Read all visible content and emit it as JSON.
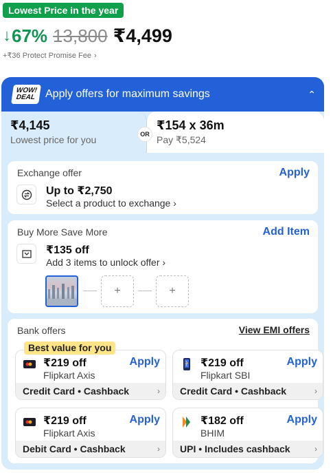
{
  "pricing": {
    "badge": "Lowest Price in the year",
    "discount": "67%",
    "mrp": "13,800",
    "final_price": "₹4,499",
    "fee_text": "+₹36 Protect Promise Fee"
  },
  "offers": {
    "header_logo_line1": "WOW!",
    "header_logo_line2": "DEAL",
    "header_title": "Apply offers for maximum savings",
    "left_tab": {
      "amount": "₹4,145",
      "sub": "Lowest price for you"
    },
    "or_label": "OR",
    "right_tab": {
      "amount": "₹154 x 36m",
      "sub": "Pay ₹5,524"
    }
  },
  "exchange": {
    "title": "Exchange offer",
    "action": "Apply",
    "main": "Up to ₹2,750",
    "sub": "Select a product to exchange"
  },
  "buy_more": {
    "title": "Buy More Save More",
    "action": "Add Item",
    "main": "₹135 off",
    "sub": "Add 3 items to unlock offer",
    "slot_symbol": "+"
  },
  "bank": {
    "title": "Bank offers",
    "view_emi": "View EMI offers",
    "best_value": "Best value for you",
    "cards": [
      {
        "amount": "₹219 off",
        "bank": "Flipkart Axis",
        "apply": "Apply",
        "footer": "Credit Card • Cashback"
      },
      {
        "amount": "₹219 off",
        "bank": "Flipkart SBI",
        "apply": "Apply",
        "footer": "Credit Card • Cashback"
      },
      {
        "amount": "₹219 off",
        "bank": "Flipkart Axis",
        "apply": "Apply",
        "footer": "Debit Card • Cashback"
      },
      {
        "amount": "₹182 off",
        "bank": "BHIM",
        "apply": "Apply",
        "footer": "UPI • Includes cashback"
      }
    ]
  },
  "colors": {
    "brand_blue": "#2361d8",
    "green": "#109f4a",
    "panel_bg": "#d9ecfb",
    "highlight_yellow": "#ffe587"
  }
}
